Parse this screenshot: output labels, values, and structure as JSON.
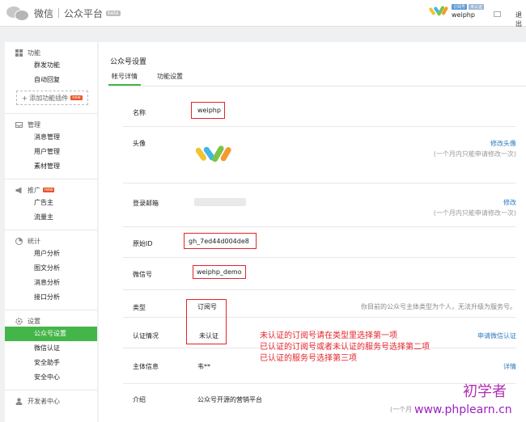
{
  "header": {
    "brand": "微信",
    "product": "公众平台",
    "beta": "beta",
    "account_badges": [
      "订阅号",
      "未认证"
    ],
    "account_name": "weiphp",
    "logout": "退出"
  },
  "sidebar": {
    "sections": [
      {
        "title": "功能",
        "icon": "grid-icon",
        "items": [
          "群发功能",
          "自动回复"
        ]
      },
      {
        "title": "管理",
        "icon": "inbox-icon",
        "items": [
          "消息管理",
          "用户管理",
          "素材管理"
        ]
      },
      {
        "title": "推广",
        "icon": "megaphone-icon",
        "tag": "new",
        "items": [
          "广告主",
          "流量主"
        ]
      },
      {
        "title": "统计",
        "icon": "pie-icon",
        "items": [
          "用户分析",
          "图文分析",
          "消息分析",
          "接口分析"
        ]
      },
      {
        "title": "设置",
        "icon": "gear-icon",
        "items": [
          "公众号设置",
          "微信认证",
          "安全助手",
          "安全中心"
        ],
        "active_item": "公众号设置"
      },
      {
        "title": "开发者中心",
        "icon": "user-icon",
        "items": []
      }
    ],
    "add_plugin": "+ 添加功能插件",
    "add_plugin_tag": "new"
  },
  "main": {
    "title": "公众号设置",
    "tabs": [
      "帐号详情",
      "功能设置"
    ],
    "active_tab": "帐号详情",
    "rows": {
      "name": {
        "label": "名称",
        "value": "weiphp"
      },
      "avatar": {
        "label": "头像",
        "action": "修改头像",
        "hint": "(一个月内只能申请修改一次)"
      },
      "email": {
        "label": "登录邮箱",
        "action": "修改",
        "hint": "(一个月内只能申请修改一次)"
      },
      "original_id": {
        "label": "原始ID",
        "value": "gh_7ed44d004de8"
      },
      "wechat_id": {
        "label": "微信号",
        "value": "weiphp_demo"
      },
      "type": {
        "label": "类型",
        "value": "订阅号",
        "hint": "你目前的公众号主体类型为个人，无法升级为服务号。"
      },
      "verify": {
        "label": "认证情况",
        "value": "未认证",
        "action": "申请微信认证"
      },
      "subject": {
        "label": "主体信息",
        "value": "韦**",
        "action": "详情"
      },
      "intro": {
        "label": "介绍",
        "value": "公众号开源的营销平台",
        "hint": "(一个月"
      }
    },
    "annotations": [
      "未认证的订阅号请在类型里选择第一项",
      "已认证的订阅号或者未认证的服务号选择第二项",
      "已认证的服务号选择第三项"
    ]
  },
  "watermark": {
    "cn": "初学者",
    "url": "www.phplearn.cn"
  },
  "colors": {
    "accent": "#44b549",
    "link": "#2e7bbf",
    "annotation_red": "#e4242b",
    "watermark": "#b12fb3"
  }
}
